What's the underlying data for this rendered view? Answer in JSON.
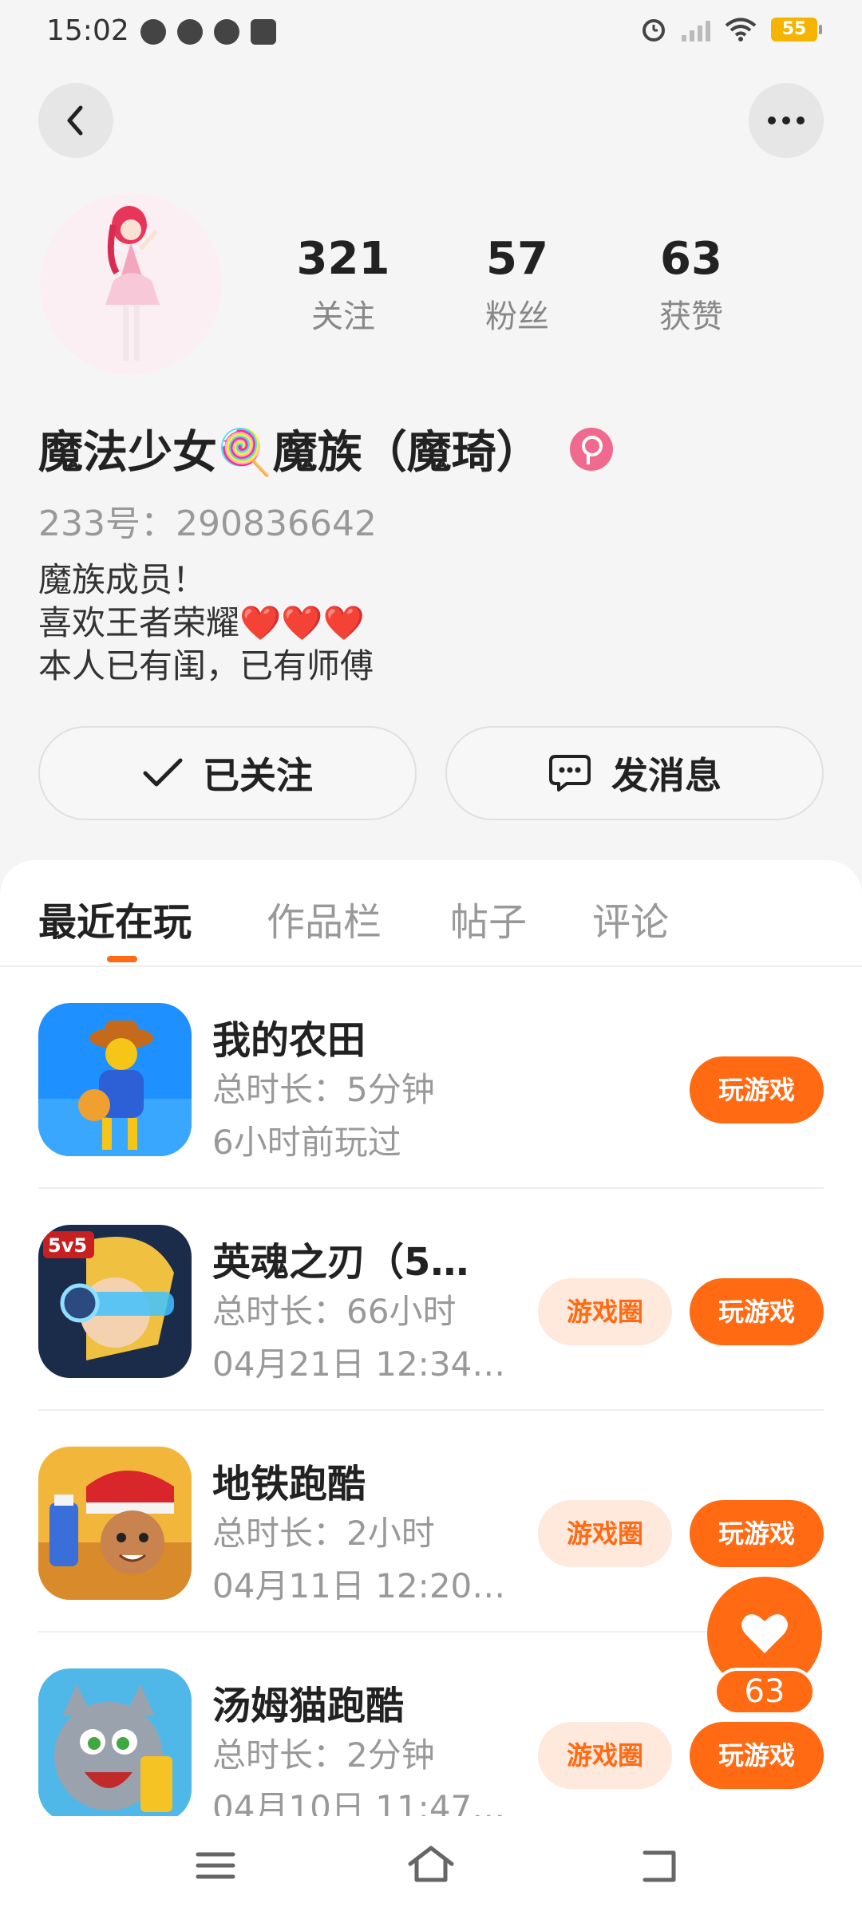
{
  "status_bar": {
    "time": "15:02",
    "battery": "55"
  },
  "profile": {
    "stats": [
      {
        "value": "321",
        "label": "关注"
      },
      {
        "value": "57",
        "label": "粉丝"
      },
      {
        "value": "63",
        "label": "获赞"
      }
    ],
    "nickname": "魔法少女🍭魔族（魔琦）",
    "uid": "233号：290836642",
    "bio": [
      "魔族成员！",
      "喜欢王者荣耀❤️❤️❤️",
      "本人已有闺，已有师傅"
    ]
  },
  "actions": {
    "follow_label": "已关注",
    "message_label": "发消息"
  },
  "tabs": [
    "最近在玩",
    "作品栏",
    "帖子",
    "评论"
  ],
  "games": [
    {
      "name": "我的农田",
      "duration": "总时长：5分钟",
      "last_played": "6小时前玩过",
      "circle": "",
      "play": "玩游戏"
    },
    {
      "name": "英魂之刃（5…",
      "duration": "总时长：66小时",
      "last_played": "04月21日 12:34…",
      "circle": "游戏圈",
      "play": "玩游戏"
    },
    {
      "name": "地铁跑酷",
      "duration": "总时长：2小时",
      "last_played": "04月11日 12:20…",
      "circle": "游戏圈",
      "play": "玩游戏"
    },
    {
      "name": "汤姆猫跑酷",
      "duration": "总时长：2分钟",
      "last_played": "04月10日 11:47…",
      "circle": "游戏圈",
      "play": "玩游戏"
    }
  ],
  "like_fab": {
    "count": "63"
  },
  "colors": {
    "accent": "#ff6a13",
    "accent_light": "#ffe8dc",
    "gender": "#f06a8f"
  }
}
